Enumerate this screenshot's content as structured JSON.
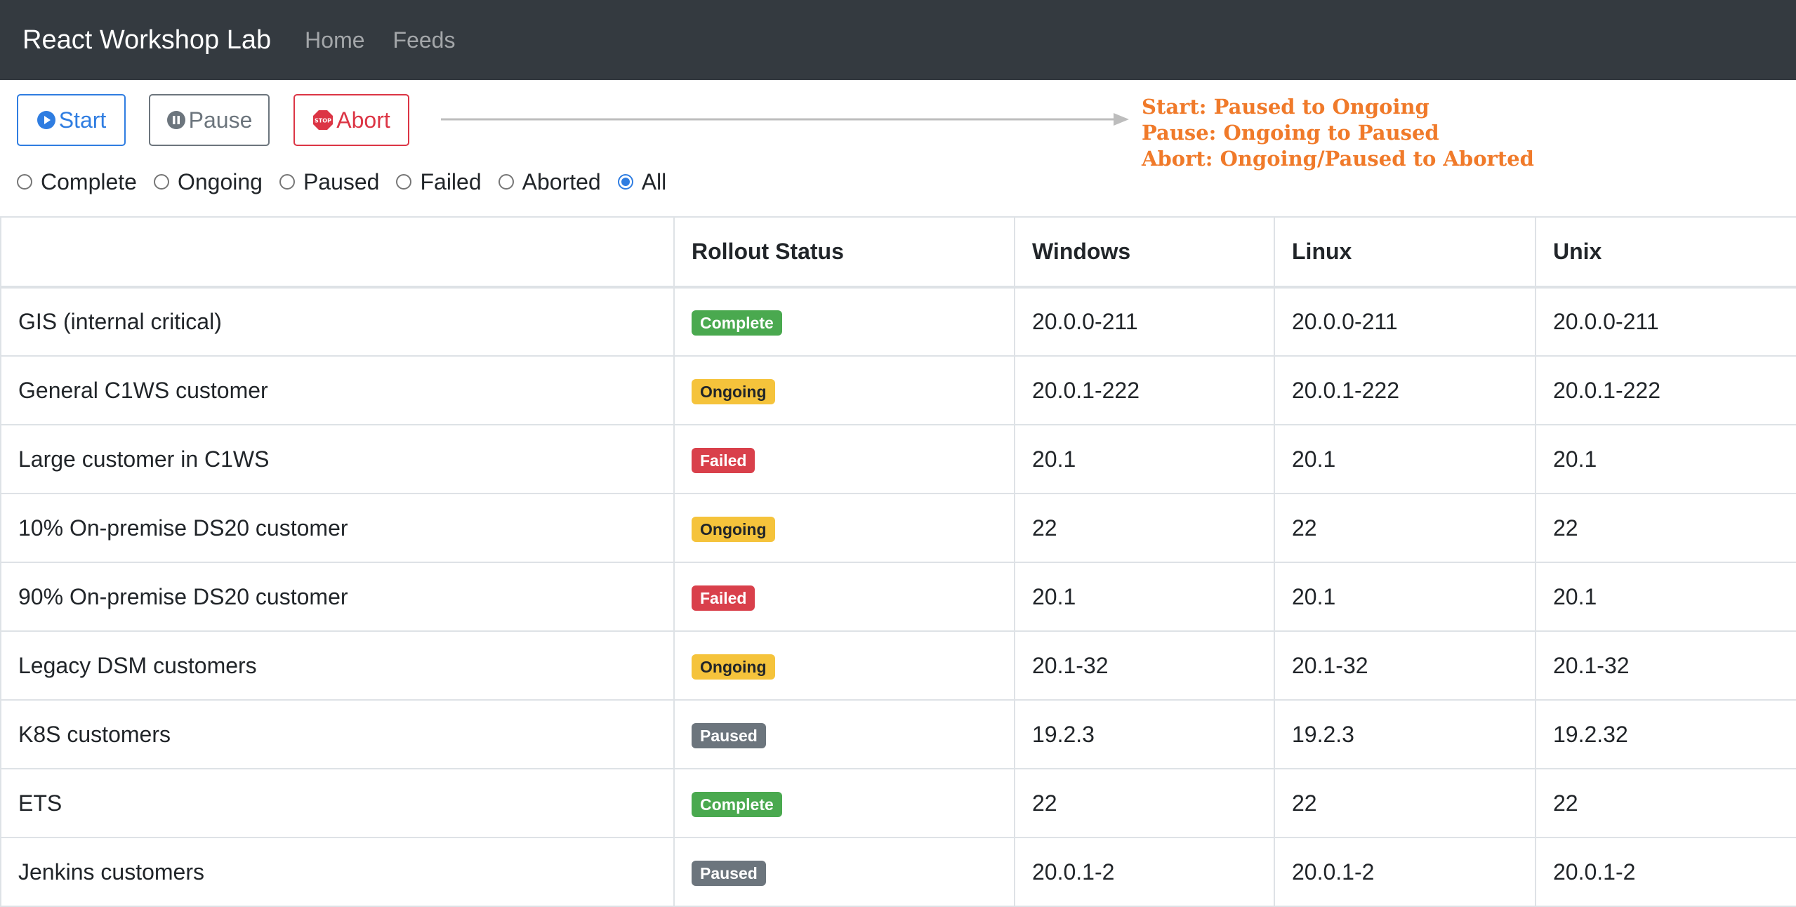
{
  "navbar": {
    "brand": "React Workshop Lab",
    "links": [
      "Home",
      "Feeds"
    ]
  },
  "toolbar": {
    "start_label": "Start",
    "pause_label": "Pause",
    "abort_label": "Abort",
    "abort_icon_text": "STOP"
  },
  "notes": [
    "Start: Paused to Ongoing",
    "Pause: Ongoing to Paused",
    "Abort: Ongoing/Paused to Aborted"
  ],
  "filters": {
    "options": [
      "Complete",
      "Ongoing",
      "Paused",
      "Failed",
      "Aborted",
      "All"
    ],
    "selected": "All"
  },
  "table": {
    "headers": [
      "",
      "Rollout Status",
      "Windows",
      "Linux",
      "Unix"
    ],
    "rows": [
      {
        "name": "GIS (internal critical)",
        "status": "Complete",
        "windows": "20.0.0-211",
        "linux": "20.0.0-211",
        "unix": "20.0.0-211"
      },
      {
        "name": "General C1WS customer",
        "status": "Ongoing",
        "windows": "20.0.1-222",
        "linux": "20.0.1-222",
        "unix": "20.0.1-222"
      },
      {
        "name": "Large customer in C1WS",
        "status": "Failed",
        "windows": "20.1",
        "linux": "20.1",
        "unix": "20.1"
      },
      {
        "name": "10% On-premise DS20 customer",
        "status": "Ongoing",
        "windows": "22",
        "linux": "22",
        "unix": "22"
      },
      {
        "name": "90% On-premise DS20 customer",
        "status": "Failed",
        "windows": "20.1",
        "linux": "20.1",
        "unix": "20.1"
      },
      {
        "name": "Legacy DSM customers",
        "status": "Ongoing",
        "windows": "20.1-32",
        "linux": "20.1-32",
        "unix": "20.1-32"
      },
      {
        "name": "K8S customers",
        "status": "Paused",
        "windows": "19.2.3",
        "linux": "19.2.3",
        "unix": "19.2.32"
      },
      {
        "name": "ETS",
        "status": "Complete",
        "windows": "22",
        "linux": "22",
        "unix": "22"
      },
      {
        "name": "Jenkins customers",
        "status": "Paused",
        "windows": "20.0.1-2",
        "linux": "20.0.1-2",
        "unix": "20.0.1-2"
      }
    ]
  },
  "colors": {
    "navbar_bg": "#343a40",
    "primary": "#2f7de1",
    "secondary": "#6c757d",
    "danger": "#dc3545",
    "note_orange": "#f07a2a",
    "complete": "#4aa94f",
    "ongoing": "#f5c33b",
    "failed": "#d9404b",
    "paused": "#6c757d"
  },
  "icons": {
    "start": "play-circle-icon",
    "pause": "pause-circle-icon",
    "abort": "stop-sign-icon",
    "arrow": "arrow-right-icon"
  }
}
